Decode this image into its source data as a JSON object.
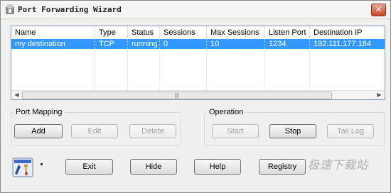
{
  "window": {
    "title": "Port Forwarding Wizard",
    "close_glyph": "✕"
  },
  "table": {
    "headers": [
      "Name",
      "Type",
      "Status",
      "Sessions",
      "Max Sessions",
      "Listen Port",
      "Destination IP"
    ],
    "rows": [
      [
        "my destination",
        "TCP",
        "running",
        "0",
        "10",
        "1234",
        "192.111.177.184"
      ]
    ],
    "scroll": {
      "left_arrow": "◀",
      "right_arrow": "▶",
      "thumb_grip": "|||"
    }
  },
  "port_mapping": {
    "label": "Port Mapping",
    "add": "Add",
    "edit": "Edit",
    "delete": "Delete"
  },
  "operation": {
    "label": "Operation",
    "start": "Start",
    "stop": "Stop",
    "tail_log": "Tail Log"
  },
  "footer": {
    "exit": "Exit",
    "hide": "Hide",
    "help": "Help",
    "registry": "Registry",
    "tools_icon": "tools-icon",
    "dropdown_glyph": "▼"
  },
  "watermark": {
    "text": "极速下载站"
  },
  "colors": {
    "selection": "#3399ff",
    "close": "#c3462a",
    "panel": "#f0f0f0"
  }
}
